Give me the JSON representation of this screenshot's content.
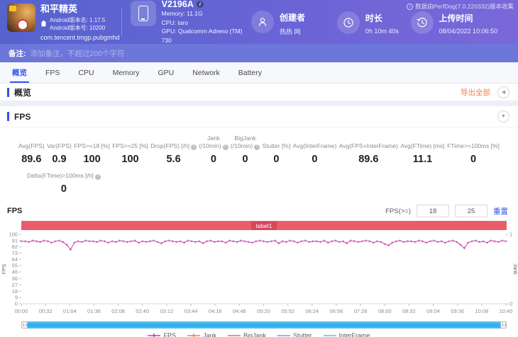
{
  "header": {
    "app": {
      "name": "和平精英",
      "version_name": "Android版本名: 1.17.5",
      "version_code": "Android版本号: 10200",
      "package": "com.tencent.tmgp.pubgmhd"
    },
    "device": {
      "model": "V2196A",
      "memory": "Memory: 11.1G",
      "cpu": "CPU: taro",
      "gpu": "GPU: Qualcomm Adreno (TM) 730"
    },
    "creator": {
      "label": "创建者",
      "value": "热热 网"
    },
    "duration": {
      "label": "时长",
      "value": "0h 10m 40s"
    },
    "upload": {
      "label": "上传时间",
      "value": "08/04/2022 10:06:50"
    },
    "collect_info": "数据由PerfDog(7.0.220332)版本收集"
  },
  "note": {
    "label": "备注:",
    "placeholder": "添加备注，不超过200个字符"
  },
  "tabs": [
    "概览",
    "FPS",
    "CPU",
    "Memory",
    "GPU",
    "Network",
    "Battery"
  ],
  "tabs_active": 0,
  "overview": {
    "title": "概览",
    "export_label": "导出全部"
  },
  "fps_section": {
    "title": "FPS",
    "stats": [
      {
        "lines": [
          "Avg(FPS)"
        ],
        "value": "89.6"
      },
      {
        "lines": [
          "Var(FPS)"
        ],
        "value": "0.9"
      },
      {
        "lines": [
          "FPS>=18 [%]"
        ],
        "value": "100"
      },
      {
        "lines": [
          "FPS>=25 [%]"
        ],
        "value": "100"
      },
      {
        "lines": [
          "Drop(FPS) [/h]"
        ],
        "value": "5.6",
        "info": true
      },
      {
        "lines": [
          "Jank",
          "(/10min)"
        ],
        "value": "0",
        "info": true
      },
      {
        "lines": [
          "BigJank",
          "(/10min)"
        ],
        "value": "0",
        "info": true
      },
      {
        "lines": [
          "Stutter [%]"
        ],
        "value": "0"
      },
      {
        "lines": [
          "Avg(InterFrame)"
        ],
        "value": "0"
      },
      {
        "lines": [
          "Avg(FPS+InterFrame)"
        ],
        "value": "89.6"
      },
      {
        "lines": [
          "Avg(FTime) [ms]"
        ],
        "value": "11.1"
      },
      {
        "lines": [
          "FTime>=100ms [%]"
        ],
        "value": "0"
      }
    ],
    "delta": {
      "label": "Delta(FTime)>100ms [/h]",
      "value": "0"
    }
  },
  "chart_data": {
    "type": "line",
    "title": "FPS",
    "label_bar": "label1",
    "controls": {
      "fps_ge_label": "FPS(>=)",
      "threshold1": "18",
      "threshold2": "25",
      "reset_label": "重置"
    },
    "x_ticks": [
      "00:00",
      "00:32",
      "01:04",
      "01:36",
      "02:08",
      "02:40",
      "03:12",
      "03:44",
      "04:16",
      "04:48",
      "05:20",
      "05:52",
      "06:24",
      "06:56",
      "07:28",
      "08:00",
      "08:32",
      "09:04",
      "09:36",
      "10:08",
      "10:40"
    ],
    "y_left": {
      "label": "FPS",
      "ticks": [
        100,
        91,
        82,
        73,
        64,
        55,
        46,
        36,
        27,
        18,
        9,
        0
      ],
      "range": [
        0,
        100
      ]
    },
    "y_right": {
      "label": "Jank",
      "ticks": [
        1,
        0
      ],
      "range": [
        0,
        1
      ]
    },
    "series": [
      {
        "name": "FPS",
        "color": "#cb3fae",
        "values": [
          90,
          90,
          89,
          91,
          90,
          89,
          91,
          90,
          88,
          90,
          91,
          89,
          85,
          78,
          88,
          90,
          89,
          91,
          90,
          90,
          89,
          91,
          90,
          88,
          90,
          89,
          91,
          90,
          89,
          90,
          91,
          88,
          90,
          89,
          90,
          91,
          89,
          87,
          90,
          91,
          90,
          89,
          90,
          88,
          91,
          90,
          89,
          90,
          87,
          90,
          91,
          89,
          90,
          90,
          88,
          91,
          90,
          89,
          91,
          90,
          89,
          88,
          90,
          91,
          90,
          89,
          90,
          91,
          87,
          90,
          89,
          91,
          90,
          88,
          90,
          91,
          89,
          90,
          90,
          89,
          91,
          88,
          90,
          91,
          89,
          90,
          87,
          91,
          90,
          89,
          90,
          91,
          90,
          88,
          90,
          89,
          86,
          84,
          88,
          90,
          91,
          89,
          90,
          90,
          89,
          91,
          90,
          88,
          90,
          91,
          89,
          90,
          88,
          90,
          91,
          89,
          85,
          80,
          88,
          90,
          91,
          89,
          90,
          88,
          91,
          90,
          89,
          91,
          90
        ]
      }
    ],
    "legend": [
      {
        "name": "FPS",
        "color": "#cb3fae",
        "marker": true
      },
      {
        "name": "Jank",
        "color": "#f0883c",
        "marker": true
      },
      {
        "name": "BigJank",
        "color": "#e8685e",
        "marker": false
      },
      {
        "name": "Stutter",
        "color": "#6da3dd",
        "marker": false
      },
      {
        "name": "InterFrame",
        "color": "#3ed0d8",
        "marker": false
      }
    ]
  }
}
